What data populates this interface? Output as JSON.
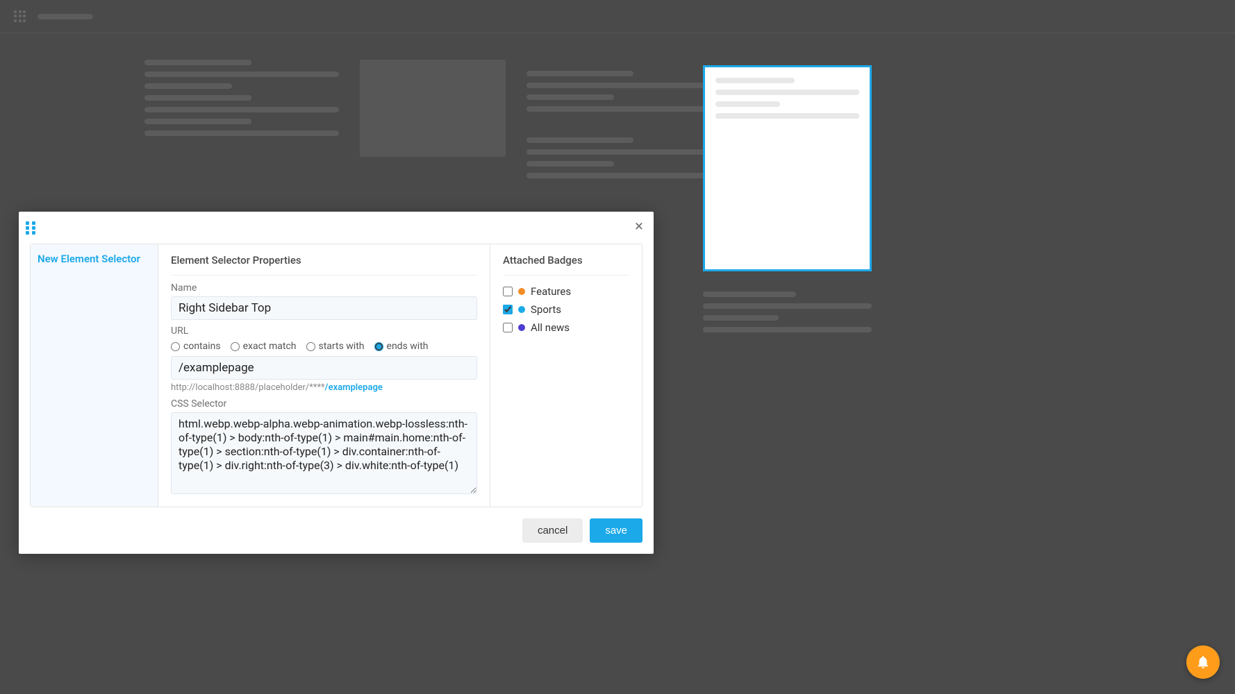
{
  "modal": {
    "left_panel_title": "New Element Selector",
    "properties_heading": "Element Selector Properties",
    "badges_heading": "Attached Badges",
    "name_label": "Name",
    "name_value": "Right Sidebar Top",
    "url_label": "URL",
    "url_options": {
      "contains": "contains",
      "exact": "exact match",
      "starts": "starts with",
      "ends": "ends with",
      "selected": "ends"
    },
    "url_value": "/examplepage",
    "url_hint_grey": "http://localhost:8888/placeholder/****",
    "url_hint_blue": "/examplepage",
    "css_label": "CSS Selector",
    "css_value": "html.webp.webp-alpha.webp-animation.webp-lossless:nth-of-type(1) > body:nth-of-type(1) > main#main.home:nth-of-type(1) > section:nth-of-type(1) > div.container:nth-of-type(1) > div.right:nth-of-type(3) > div.white:nth-of-type(1)",
    "cancel_label": "cancel",
    "save_label": "save"
  },
  "badges": [
    {
      "label": "Features",
      "color": "#f28c28",
      "checked": false
    },
    {
      "label": "Sports",
      "color": "#1ca9e9",
      "checked": true
    },
    {
      "label": "All news",
      "color": "#4b3ecf",
      "checked": false
    }
  ]
}
